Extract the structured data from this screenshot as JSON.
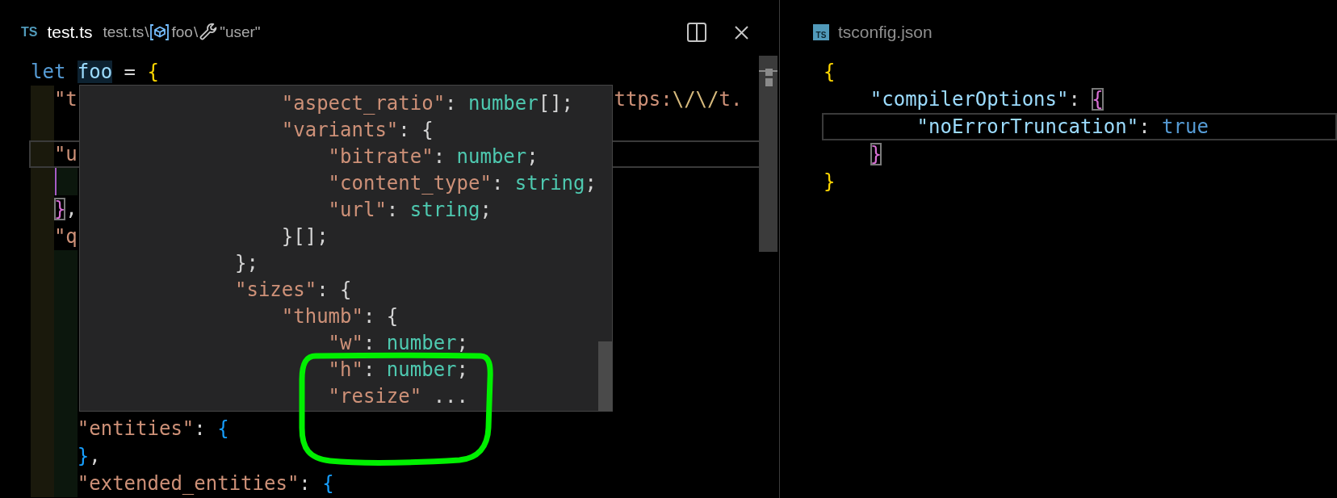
{
  "editor_groups": [
    {
      "active": true,
      "tab": {
        "kind": "ts",
        "badge": "TS",
        "title": "test.ts"
      },
      "breadcrumbs": [
        {
          "kind": "file",
          "label": "test.ts",
          "separator": "\\"
        },
        {
          "kind": "variable",
          "label": "foo",
          "separator": "\\"
        },
        {
          "kind": "property",
          "label": "\"user\""
        }
      ],
      "code_lines": [
        {
          "kind": "code",
          "current": false,
          "tokens": [
            {
              "kind": "keyword",
              "text": "let "
            },
            {
              "kind": "hover-target",
              "text": "foo"
            },
            {
              "kind": "punctuation",
              "text": " = "
            },
            {
              "kind": "bracket-1",
              "text": "{"
            }
          ],
          "children": [
            {
              "kind": "code",
              "current": false,
              "tokens": [
                {
                  "kind": "string",
                  "text": "\"t"
                }
              ],
              "tail": [
                {
                  "kind": "string",
                  "text": "ttps:"
                },
                {
                  "kind": "escape",
                  "text": "\\/"
                },
                {
                  "kind": "escape",
                  "text": "\\/"
                },
                {
                  "kind": "string",
                  "text": "t."
                }
              ]
            },
            {
              "kind": "blank",
              "current": false
            },
            {
              "kind": "code",
              "current": true,
              "tokens": [
                {
                  "kind": "string",
                  "text": "\"u"
                }
              ],
              "children": [
                {
                  "kind": "blank",
                  "current": false
                }
              ]
            },
            {
              "kind": "code",
              "current": false,
              "tokens": [
                {
                  "kind": "bracket-match",
                  "text": "}"
                },
                {
                  "kind": "punctuation",
                  "text": ","
                }
              ]
            },
            {
              "kind": "code",
              "current": false,
              "tokens": [
                {
                  "kind": "string",
                  "text": "\"q"
                }
              ],
              "children": [
                {
                  "kind": "blank",
                  "current": false
                },
                {
                  "kind": "blank",
                  "current": false
                },
                {
                  "kind": "blank",
                  "current": false
                },
                {
                  "kind": "blank",
                  "current": false
                },
                {
                  "kind": "blank",
                  "current": false
                },
                {
                  "kind": "blank",
                  "current": false
                },
                {
                  "kind": "code",
                  "current": false,
                  "tokens": [
                    {
                      "kind": "string",
                      "text": "\"entities\""
                    },
                    {
                      "kind": "punctuation",
                      "text": ": "
                    },
                    {
                      "kind": "bracket-3",
                      "text": "{"
                    }
                  ]
                },
                {
                  "kind": "code",
                  "current": false,
                  "tokens": [
                    {
                      "kind": "bracket-3",
                      "text": "}"
                    },
                    {
                      "kind": "punctuation",
                      "text": ","
                    }
                  ]
                },
                {
                  "kind": "code",
                  "current": false,
                  "tokens": [
                    {
                      "kind": "string",
                      "text": "\"extended_entities\""
                    },
                    {
                      "kind": "punctuation",
                      "text": ": "
                    },
                    {
                      "kind": "bracket-3",
                      "text": "{"
                    }
                  ]
                }
              ]
            }
          ]
        }
      ],
      "hover": {
        "lines": [
          {
            "kind": "group",
            "children": [
              {
                "kind": "code",
                "tokens": [
                  {
                    "kind": "string",
                    "text": "\"aspect_ratio\""
                  },
                  {
                    "kind": "punctuation",
                    "text": ": "
                  },
                  {
                    "kind": "type",
                    "text": "number"
                  },
                  {
                    "kind": "punctuation",
                    "text": "[];"
                  }
                ]
              },
              {
                "kind": "code",
                "tokens": [
                  {
                    "kind": "string",
                    "text": "\"variants\""
                  },
                  {
                    "kind": "punctuation",
                    "text": ": {"
                  }
                ],
                "children": [
                  {
                    "kind": "code",
                    "tokens": [
                      {
                        "kind": "string",
                        "text": "\"bitrate\""
                      },
                      {
                        "kind": "punctuation",
                        "text": ": "
                      },
                      {
                        "kind": "type",
                        "text": "number"
                      },
                      {
                        "kind": "punctuation",
                        "text": ";"
                      }
                    ]
                  },
                  {
                    "kind": "code",
                    "tokens": [
                      {
                        "kind": "string",
                        "text": "\"content_type\""
                      },
                      {
                        "kind": "punctuation",
                        "text": ": "
                      },
                      {
                        "kind": "type",
                        "text": "string"
                      },
                      {
                        "kind": "punctuation",
                        "text": ";"
                      }
                    ]
                  },
                  {
                    "kind": "code",
                    "tokens": [
                      {
                        "kind": "string",
                        "text": "\"url\""
                      },
                      {
                        "kind": "punctuation",
                        "text": ": "
                      },
                      {
                        "kind": "type",
                        "text": "string"
                      },
                      {
                        "kind": "punctuation",
                        "text": ";"
                      }
                    ]
                  }
                ]
              },
              {
                "kind": "code",
                "tokens": [
                  {
                    "kind": "punctuation",
                    "text": "}[];"
                  }
                ]
              }
            ]
          },
          {
            "kind": "code",
            "tokens": [
              {
                "kind": "punctuation",
                "text": "};"
              }
            ]
          },
          {
            "kind": "code",
            "tokens": [
              {
                "kind": "string",
                "text": "\"sizes\""
              },
              {
                "kind": "punctuation",
                "text": ": {"
              }
            ],
            "children": [
              {
                "kind": "code",
                "tokens": [
                  {
                    "kind": "string",
                    "text": "\"thumb\""
                  },
                  {
                    "kind": "punctuation",
                    "text": ": {"
                  }
                ],
                "children": [
                  {
                    "kind": "code",
                    "tokens": [
                      {
                        "kind": "string",
                        "text": "\"w\""
                      },
                      {
                        "kind": "punctuation",
                        "text": ": "
                      },
                      {
                        "kind": "type",
                        "text": "number"
                      },
                      {
                        "kind": "punctuation",
                        "text": ";"
                      }
                    ]
                  },
                  {
                    "kind": "code",
                    "tokens": [
                      {
                        "kind": "string",
                        "text": "\"h\""
                      },
                      {
                        "kind": "punctuation",
                        "text": ": "
                      },
                      {
                        "kind": "type",
                        "text": "number"
                      },
                      {
                        "kind": "punctuation",
                        "text": ";"
                      }
                    ]
                  },
                  {
                    "kind": "code",
                    "tokens": [
                      {
                        "kind": "string",
                        "text": "\"resize\""
                      },
                      {
                        "kind": "punctuation",
                        "text": " ..."
                      }
                    ]
                  }
                ]
              }
            ]
          }
        ]
      }
    },
    {
      "active": false,
      "tab": {
        "kind": "tsconfig",
        "badge": "TS",
        "title": "tsconfig.json"
      },
      "code_lines": [
        {
          "kind": "code",
          "current": false,
          "tokens": [
            {
              "kind": "bracket-1",
              "text": "{"
            }
          ],
          "children": [
            {
              "kind": "code",
              "current": false,
              "tokens": [
                {
                  "kind": "key",
                  "text": "\"compilerOptions\""
                },
                {
                  "kind": "punctuation",
                  "text": ": "
                },
                {
                  "kind": "bracket-match",
                  "text": "{"
                }
              ],
              "children": [
                {
                  "kind": "code",
                  "current": true,
                  "tokens": [
                    {
                      "kind": "key",
                      "text": "\"noErrorTruncation\""
                    },
                    {
                      "kind": "punctuation",
                      "text": ": "
                    },
                    {
                      "kind": "boolean",
                      "text": "true"
                    }
                  ]
                }
              ]
            },
            {
              "kind": "code",
              "current": false,
              "tokens": [
                {
                  "kind": "bracket-match",
                  "text": "}"
                }
              ]
            }
          ]
        },
        {
          "kind": "code",
          "current": false,
          "tokens": [
            {
              "kind": "bracket-1",
              "text": "}"
            }
          ]
        }
      ]
    }
  ]
}
